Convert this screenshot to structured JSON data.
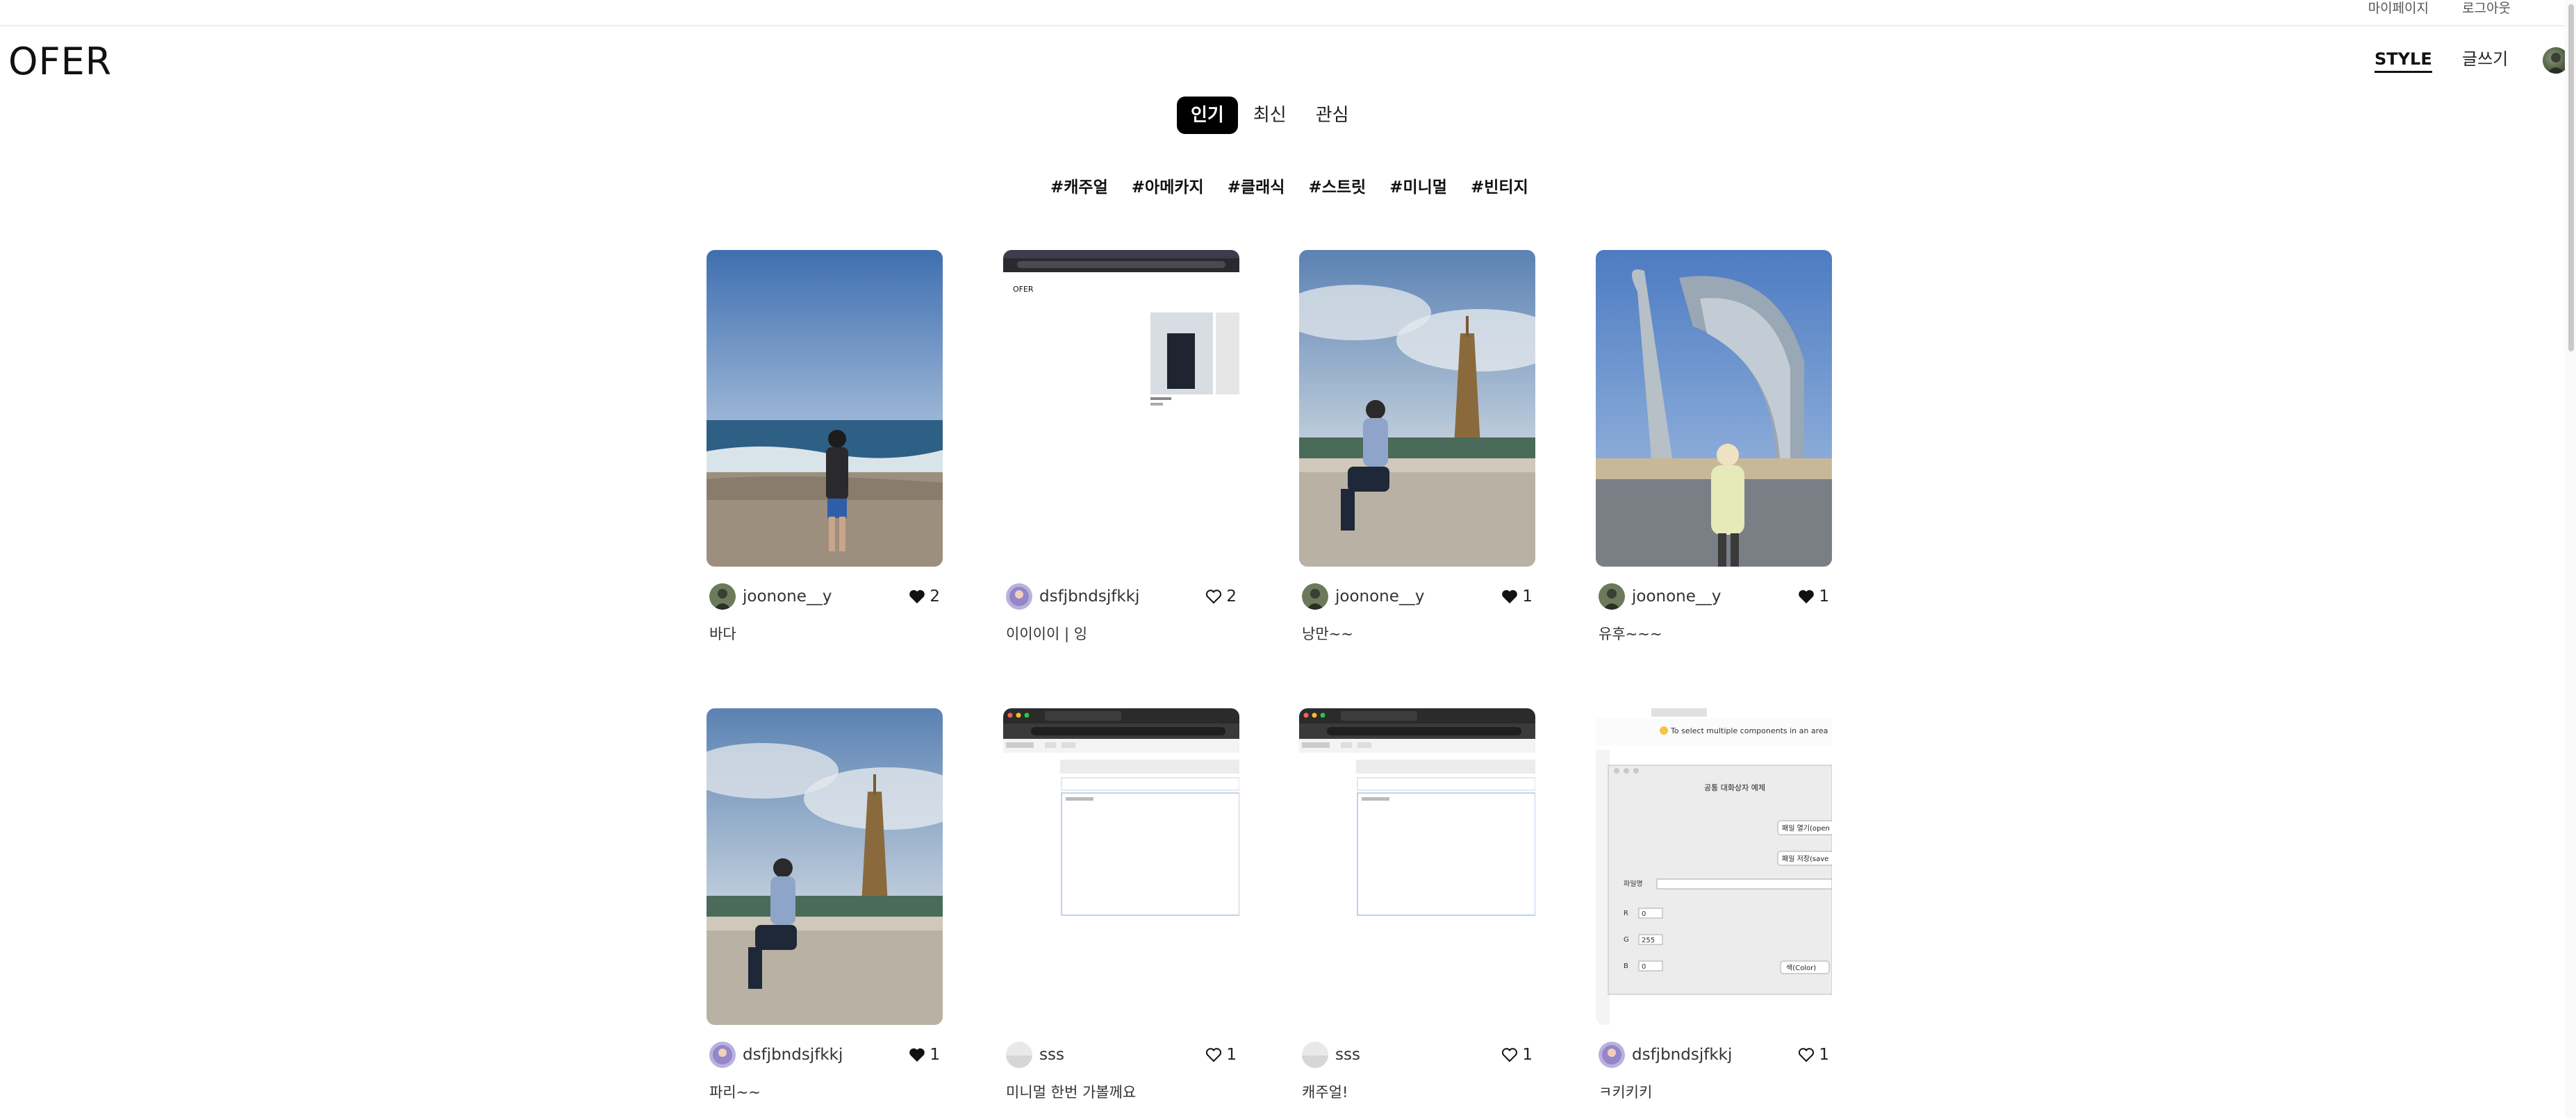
{
  "topbar": {
    "mypage": "마이페이지",
    "logout": "로그아웃"
  },
  "header": {
    "logo": "OFER",
    "nav_style": "STYLE",
    "nav_write": "글쓰기"
  },
  "tabs": [
    {
      "label": "인기",
      "active": true
    },
    {
      "label": "최신",
      "active": false
    },
    {
      "label": "관심",
      "active": false
    }
  ],
  "hashtags": [
    "#캐주얼",
    "#아메카지",
    "#클래식",
    "#스트릿",
    "#미니멀",
    "#빈티지"
  ],
  "posts": [
    {
      "user": "joonone__y",
      "likes": "2",
      "liked": true,
      "caption": "바다",
      "image": "beach-photo",
      "avatar": "green"
    },
    {
      "user": "dsfjbndsjfkkj",
      "likes": "2",
      "liked": false,
      "caption": "이이이이 | 잉",
      "image": "app-screenshot",
      "avatar": "purple"
    },
    {
      "user": "joonone__y",
      "likes": "1",
      "liked": true,
      "caption": "낭만~~",
      "image": "eiffel-tower-photo",
      "avatar": "green"
    },
    {
      "user": "joonone__y",
      "likes": "1",
      "liked": true,
      "caption": "유후~~~",
      "image": "modern-tower-photo",
      "avatar": "green"
    },
    {
      "user": "dsfjbndsjfkkj",
      "likes": "1",
      "liked": true,
      "caption": "파리~~",
      "image": "eiffel-tower-photo",
      "avatar": "purple"
    },
    {
      "user": "sss",
      "likes": "1",
      "liked": false,
      "caption": "미니멀 한번 가볼께요",
      "image": "browser-form-screenshot",
      "avatar": "gray"
    },
    {
      "user": "sss",
      "likes": "1",
      "liked": false,
      "caption": "캐주얼!",
      "image": "browser-form-screenshot",
      "avatar": "gray"
    },
    {
      "user": "dsfjbndsjfkkj",
      "likes": "1",
      "liked": false,
      "caption": "ㅋ키키키",
      "image": "java-dialog-screenshot",
      "avatar": "purple"
    }
  ],
  "thumb_text": {
    "app_logo": "OFER",
    "tip": "To select multiple components in an area",
    "dialog_title": "공통 대화상자 예제",
    "open_button": "패일 열기(open",
    "save_button": "패일 저장(save",
    "filename_label": "파일명",
    "r_label": "R",
    "r_value": "0",
    "g_label": "G",
    "g_value": "255",
    "b_label": "B",
    "b_value": "0",
    "color_button": "색(Color)"
  },
  "colors": {
    "accent": "#000000",
    "heart": "#111111"
  }
}
